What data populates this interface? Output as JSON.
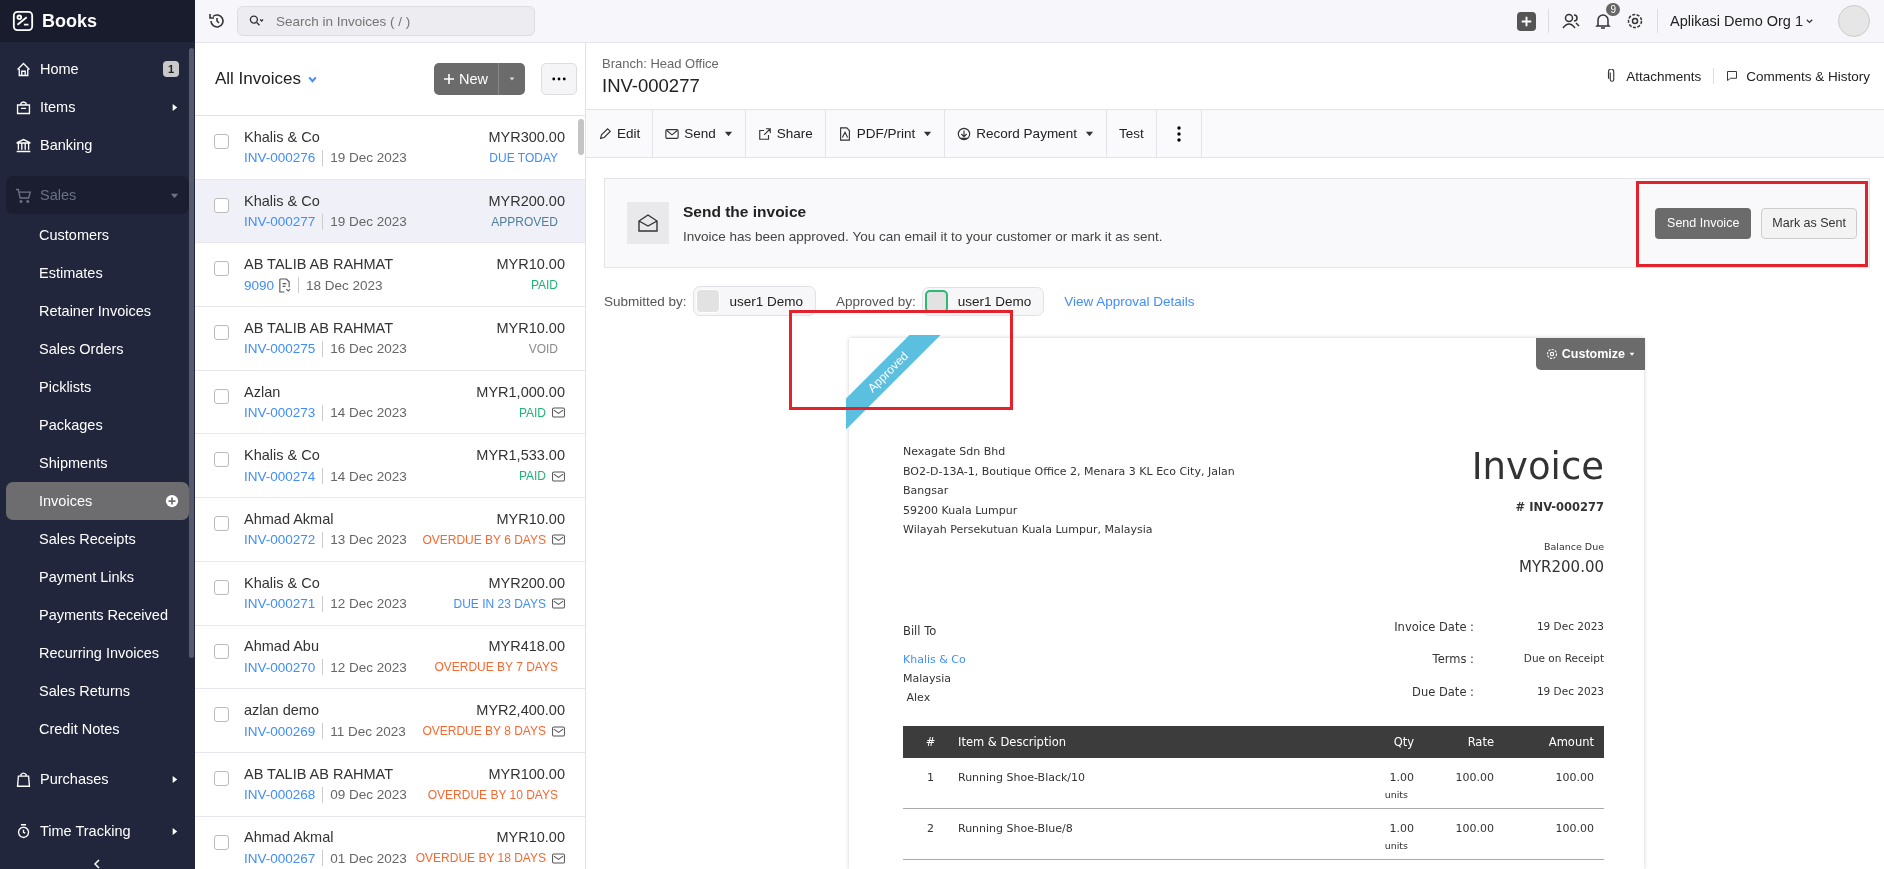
{
  "sidebar": {
    "brand": "Books",
    "items": [
      {
        "label": "Home",
        "badge": "1",
        "has_submenu": false
      },
      {
        "label": "Items",
        "has_submenu": true,
        "expanded": false
      },
      {
        "label": "Banking",
        "has_submenu": false
      },
      {
        "label": "Sales",
        "has_submenu": true,
        "expanded": true,
        "children": [
          {
            "label": "Customers",
            "selected": false
          },
          {
            "label": "Estimates",
            "selected": false
          },
          {
            "label": "Retainer Invoices",
            "selected": false
          },
          {
            "label": "Sales Orders",
            "selected": false
          },
          {
            "label": "Picklists",
            "selected": false
          },
          {
            "label": "Packages",
            "selected": false
          },
          {
            "label": "Shipments",
            "selected": false
          },
          {
            "label": "Invoices",
            "selected": true
          },
          {
            "label": "Sales Receipts",
            "selected": false
          },
          {
            "label": "Payment Links",
            "selected": false
          },
          {
            "label": "Payments Received",
            "selected": false
          },
          {
            "label": "Recurring Invoices",
            "selected": false
          },
          {
            "label": "Sales Returns",
            "selected": false
          },
          {
            "label": "Credit Notes",
            "selected": false
          }
        ]
      },
      {
        "label": "Purchases",
        "has_submenu": true,
        "expanded": false
      },
      {
        "label": "Time Tracking",
        "has_submenu": true,
        "expanded": false
      }
    ]
  },
  "top_bar": {
    "search": {
      "placeholder": "Search in Invoices ( / )"
    },
    "notifications": "9",
    "organization": "Aplikasi Demo Org 1"
  },
  "invoice_list": {
    "title": "All Invoices",
    "new_label": "New",
    "invoices": [
      {
        "customer": "Khalis & Co",
        "number": "INV-000276",
        "date": "19 Dec 2023",
        "amount": "MYR300.00",
        "status": "DUE TODAY",
        "kind": "due",
        "emailed": false,
        "doc_icon": false,
        "selected": false
      },
      {
        "customer": "Khalis & Co",
        "number": "INV-000277",
        "date": "19 Dec 2023",
        "amount": "MYR200.00",
        "status": "APPROVED",
        "kind": "approved",
        "emailed": false,
        "doc_icon": false,
        "selected": true
      },
      {
        "customer": "AB TALIB AB RAHMAT",
        "number": "9090",
        "date": "18 Dec 2023",
        "amount": "MYR10.00",
        "status": "PAID",
        "kind": "paid",
        "emailed": false,
        "doc_icon": true,
        "selected": false
      },
      {
        "customer": "AB TALIB AB RAHMAT",
        "number": "INV-000275",
        "date": "16 Dec 2023",
        "amount": "MYR10.00",
        "status": "VOID",
        "kind": "void",
        "emailed": false,
        "doc_icon": false,
        "selected": false
      },
      {
        "customer": "Azlan",
        "number": "INV-000273",
        "date": "14 Dec 2023",
        "amount": "MYR1,000.00",
        "status": "PAID",
        "kind": "paid",
        "emailed": true,
        "doc_icon": false,
        "selected": false
      },
      {
        "customer": "Khalis & Co",
        "number": "INV-000274",
        "date": "14 Dec 2023",
        "amount": "MYR1,533.00",
        "status": "PAID",
        "kind": "paid",
        "emailed": true,
        "doc_icon": false,
        "selected": false
      },
      {
        "customer": "Ahmad Akmal",
        "number": "INV-000272",
        "date": "13 Dec 2023",
        "amount": "MYR10.00",
        "status": "OVERDUE BY 6 DAYS",
        "kind": "overdue",
        "emailed": true,
        "doc_icon": false,
        "selected": false
      },
      {
        "customer": "Khalis & Co",
        "number": "INV-000271",
        "date": "12 Dec 2023",
        "amount": "MYR200.00",
        "status": "DUE IN 23 DAYS",
        "kind": "due",
        "emailed": true,
        "doc_icon": false,
        "selected": false
      },
      {
        "customer": "Ahmad Abu",
        "number": "INV-000270",
        "date": "12 Dec 2023",
        "amount": "MYR418.00",
        "status": "OVERDUE BY 7 DAYS",
        "kind": "overdue",
        "emailed": false,
        "doc_icon": false,
        "selected": false
      },
      {
        "customer": "azlan demo",
        "number": "INV-000269",
        "date": "11 Dec 2023",
        "amount": "MYR2,400.00",
        "status": "OVERDUE BY 8 DAYS",
        "kind": "overdue",
        "emailed": true,
        "doc_icon": false,
        "selected": false
      },
      {
        "customer": "AB TALIB AB RAHMAT",
        "number": "INV-000268",
        "date": "09 Dec 2023",
        "amount": "MYR100.00",
        "status": "OVERDUE BY 10 DAYS",
        "kind": "overdue",
        "emailed": false,
        "doc_icon": false,
        "selected": false
      },
      {
        "customer": "Ahmad Akmal",
        "number": "INV-000267",
        "date": "01 Dec 2023",
        "amount": "MYR10.00",
        "status": "OVERDUE BY 18 DAYS",
        "kind": "overdue",
        "emailed": true,
        "doc_icon": false,
        "selected": false
      }
    ]
  },
  "detail": {
    "branch": "Branch: Head Office",
    "number": "INV-000277",
    "attachments": "Attachments",
    "comments": "Comments & History",
    "toolbar": [
      {
        "label": "Edit",
        "dropdown": false
      },
      {
        "label": "Send",
        "dropdown": true
      },
      {
        "label": "Share",
        "dropdown": false
      },
      {
        "label": "PDF/Print",
        "dropdown": true
      },
      {
        "label": "Record Payment",
        "dropdown": true
      },
      {
        "label": "Test",
        "dropdown": false
      }
    ],
    "banner": {
      "title": "Send the invoice",
      "text": "Invoice has been approved. You can email it to your customer or mark it as sent.",
      "primary": "Send Invoice",
      "secondary": "Mark as Sent"
    },
    "approval": {
      "submitted_label": "Submitted by:",
      "submitted_user": "user1 Demo",
      "approved_label": "Approved by:",
      "approved_user": "user1 Demo",
      "link": "View Approval Details"
    },
    "document": {
      "ribbon": "Approved",
      "customize": "Customize",
      "company": [
        "Nexagate Sdn Bhd",
        "BO2-D-13A-1, Boutique Office 2, Menara 3 KL Eco City, Jalan",
        "Bangsar",
        "59200 Kuala Lumpur",
        "Wilayah Persekutuan Kuala Lumpur, Malaysia"
      ],
      "title": "Invoice",
      "number": "# INV-000277",
      "balance_label": "Balance Due",
      "balance": "MYR200.00",
      "bill_to": "Bill To",
      "customer": "Khalis & Co",
      "bill_lines": [
        "Malaysia",
        " Alex"
      ],
      "meta": [
        {
          "label": "Invoice Date :",
          "value": "19 Dec 2023"
        },
        {
          "label": "Terms :",
          "value": "Due on Receipt"
        },
        {
          "label": "Due Date :",
          "value": "19 Dec 2023"
        }
      ],
      "columns": [
        "#",
        "Item & Description",
        "Qty",
        "Rate",
        "Amount"
      ],
      "rows": [
        {
          "index": "1",
          "item": "Running Shoe-Black/10",
          "qty": "1.00",
          "unit": "units",
          "rate": "100.00",
          "amount": "100.00"
        },
        {
          "index": "2",
          "item": "Running Shoe-Blue/8",
          "qty": "1.00",
          "unit": "units",
          "rate": "100.00",
          "amount": "100.00"
        }
      ]
    }
  }
}
